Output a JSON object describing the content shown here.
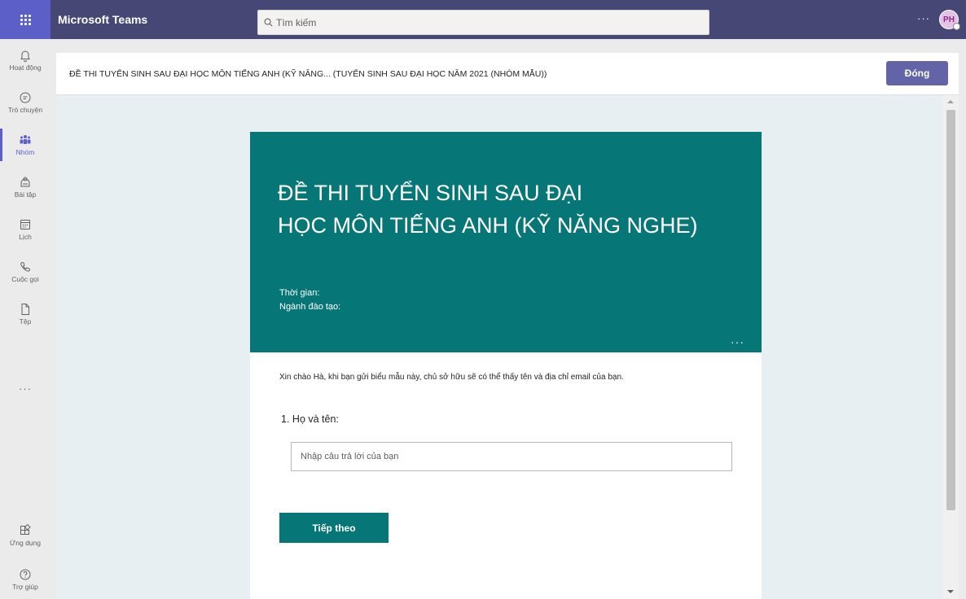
{
  "topbar": {
    "app_title": "Microsoft Teams",
    "search_placeholder": "Tìm kiếm",
    "more": "···",
    "avatar_initials": "PH"
  },
  "rail": {
    "items": [
      {
        "label": "Hoạt động",
        "icon": "bell-icon"
      },
      {
        "label": "Trò chuyện",
        "icon": "chat-icon"
      },
      {
        "label": "Nhóm",
        "icon": "teams-icon",
        "active": true
      },
      {
        "label": "Bài tập",
        "icon": "assignments-icon"
      },
      {
        "label": "Lịch",
        "icon": "calendar-icon"
      },
      {
        "label": "Cuộc gọi",
        "icon": "phone-icon"
      },
      {
        "label": "Tệp",
        "icon": "file-icon"
      }
    ],
    "more": "···",
    "bottom": [
      {
        "label": "Ứng dụng",
        "icon": "apps-icon"
      },
      {
        "label": "Trợ giúp",
        "icon": "help-icon"
      }
    ]
  },
  "header": {
    "title": "ĐỀ THI TUYỂN SINH SAU ĐẠI HỌC MÔN TIẾNG ANH (KỸ NĂNG... (TUYỂN SINH SAU ĐẠI HỌC NĂM 2021 (NHÓM MẪU))",
    "close_label": "Đóng"
  },
  "form": {
    "title_line1": "ĐỀ THI TUYỂN SINH SAU ĐẠI",
    "title_line2": "HỌC MÔN TIẾNG ANH (KỸ NĂNG NGHE)",
    "time_label": "Thời gian:",
    "program_label": "Ngành đào tạo:",
    "banner_more": "···",
    "greeting": "Xin chào Hà, khi bạn gửi biểu mẫu này, chủ sở hữu sẽ có thể thấy tên và địa chỉ email của bạn.",
    "question_number": "1.",
    "question_label": "Họ và tên:",
    "answer_placeholder": "Nhập câu trả lời của bạn",
    "next_label": "Tiếp theo"
  },
  "colors": {
    "topbar": "#464775",
    "accent": "#5b5fc7",
    "form_theme": "#077677",
    "content_bg": "#e8eff3"
  }
}
